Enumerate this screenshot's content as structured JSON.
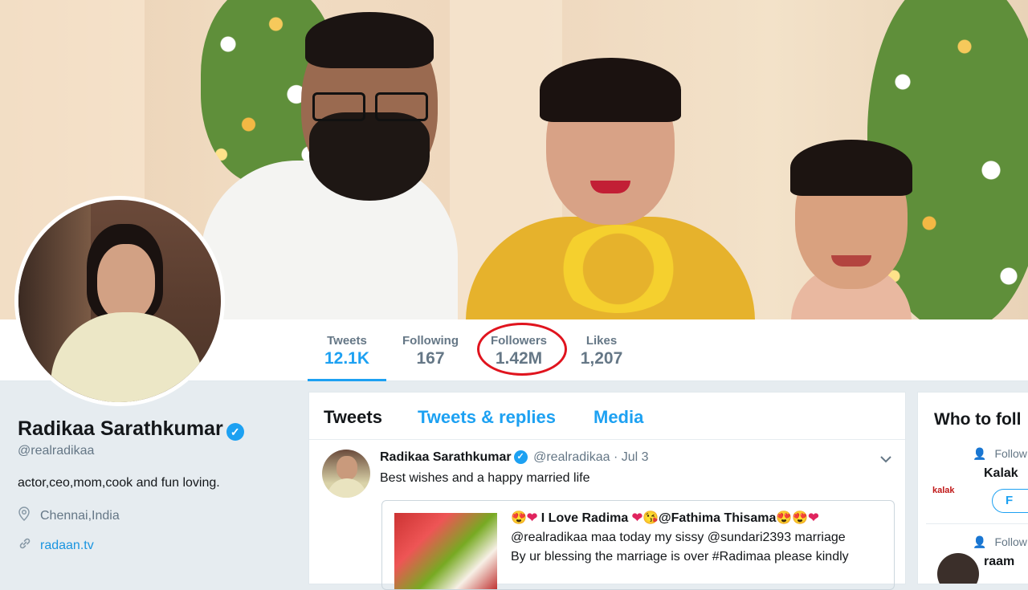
{
  "profile": {
    "name": "Radikaa Sarathkumar",
    "handle": "@realradikaa",
    "bio": "actor,ceo,mom,cook and fun loving.",
    "location": "Chennai,India",
    "website": "radaan.tv"
  },
  "stats": {
    "tweets_label": "Tweets",
    "tweets_value": "12.1K",
    "following_label": "Following",
    "following_value": "167",
    "followers_label": "Followers",
    "followers_value": "1.42M",
    "likes_label": "Likes",
    "likes_value": "1,207"
  },
  "timeline": {
    "tabs": [
      "Tweets",
      "Tweets & replies",
      "Media"
    ],
    "tweet": {
      "author": "Radikaa Sarathkumar",
      "handle": "@realradikaa",
      "separator": "·",
      "date": "Jul 3",
      "text": "Best wishes and a happy married life",
      "quote": {
        "title": "I Love Radima",
        "title_mention": "@Fathima Thisama",
        "line1": "@realradikaa maa today my sissy @sundari2393 marriage",
        "line2": "By ur blessing the marriage is over #Radimaa please kindly"
      }
    }
  },
  "who_to_follow": {
    "title": "Who to foll",
    "items": [
      {
        "follows_label": "Follow",
        "name": "Kalak",
        "logo_text": "kalak",
        "button": "F"
      },
      {
        "follows_label": "Follow",
        "name": "raam"
      }
    ]
  },
  "colors": {
    "accent": "#1da1f2",
    "highlight_circle": "#e0141e",
    "background": "#e6ecf0"
  },
  "icons": {
    "verified": "verified-badge-icon",
    "location": "location-pin-icon",
    "link": "link-icon",
    "caret": "chevron-down-icon",
    "follows": "person-icon"
  }
}
